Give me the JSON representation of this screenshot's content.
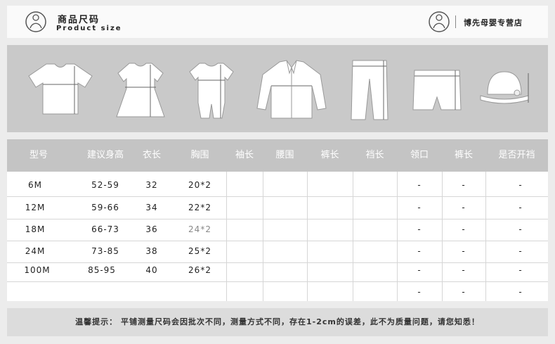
{
  "header": {
    "title": "商品尺码",
    "subtitle": "Product size",
    "shop_name": "博先母婴专营店"
  },
  "icons": [
    "baby-logo-icon",
    "tshirt-icon",
    "dress-icon",
    "romper-icon",
    "jacket-icon",
    "pants-icon",
    "shorts-icon",
    "hat-icon"
  ],
  "table": {
    "headers": [
      "型号",
      "建议身高",
      "衣长",
      "胸围",
      "袖长",
      "腰围",
      "裤长",
      "裆长",
      "领口",
      "裤长",
      "是否开裆"
    ],
    "rows": [
      [
        "6M",
        "52-59",
        "32",
        "20*2",
        "",
        "",
        "",
        "",
        "-",
        "-",
        "-"
      ],
      [
        "12M",
        "59-66",
        "34",
        "22*2",
        "",
        "",
        "",
        "",
        "-",
        "-",
        "-"
      ],
      [
        "18M",
        "66-73",
        "36",
        "24*2",
        "",
        "",
        "",
        "",
        "-",
        "-",
        "-"
      ],
      [
        "24M",
        "73-85",
        "38",
        "25*2",
        "",
        "",
        "",
        "",
        "-",
        "-",
        "-"
      ],
      [
        "100M",
        "85-95",
        "40",
        "26*2",
        "",
        "",
        "",
        "",
        "-",
        "-",
        "-"
      ],
      [
        "",
        "",
        "",
        "",
        "",
        "",
        "",
        "",
        "-",
        "-",
        "-"
      ]
    ]
  },
  "notice": "温馨提示： 平铺测量尺码会因批次不同，测量方式不同，存在1-2cm的误差，此不为质量问题，请您知悉！",
  "colors": {
    "header_bg": "#fafafa",
    "garment_strip": "#c9c9c9",
    "table_header": "#c4c4c4",
    "notice_bg": "#dcdcdc"
  }
}
